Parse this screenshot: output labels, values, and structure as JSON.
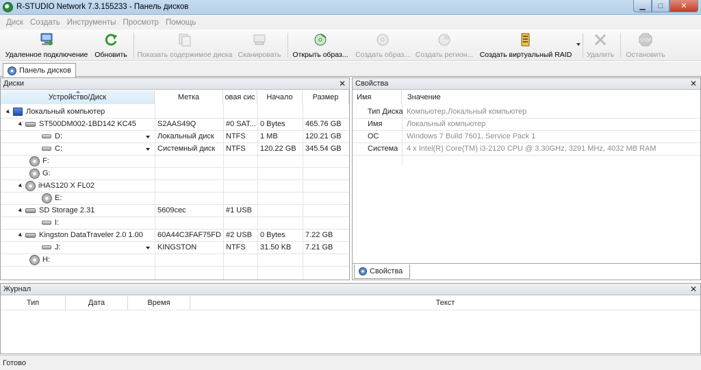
{
  "window": {
    "title": "R-STUDIO Network 7.3.155233 - Панель дисков",
    "min_glyph": "▁",
    "max_glyph": "□",
    "close_glyph": "✕"
  },
  "menu": [
    "Диск",
    "Создать",
    "Инструменты",
    "Просмотр",
    "Помощь"
  ],
  "toolbar": {
    "remote_connect": "Удаленное подключение",
    "refresh": "Обновить",
    "show_disk_contents": "Показать содержимое диска",
    "scan": "Сканировать",
    "open_image": "Открыть образ...",
    "create_image": "Создать образ...",
    "create_region": "Создать регион...",
    "create_virtual_raid": "Создать виртуальный RAID",
    "delete": "Удалить",
    "stop": "Остановить",
    "stop_badge": "STOP"
  },
  "doc_tab": {
    "label": "Панель дисков"
  },
  "disks_pane": {
    "title": "Диски",
    "close": "✕",
    "columns": [
      "Устройство/Диск",
      "Метка",
      "овая сис",
      "Начало",
      "Размер"
    ],
    "rows": [
      {
        "device": "Локальный компьютер",
        "label": "",
        "fs": "",
        "start": "",
        "size": ""
      },
      {
        "device": "ST500DM002-1BD142 KC45",
        "label": "S2AAS49Q",
        "fs": "#0 SAT...",
        "start": "0 Bytes",
        "size": "465.76 GB"
      },
      {
        "device": "D:",
        "label": "Локальный диск",
        "fs": "NTFS",
        "start": "1 MB",
        "size": "120.21 GB"
      },
      {
        "device": "C:",
        "label": "Системный диск",
        "fs": "NTFS",
        "start": "120.22 GB",
        "size": "345.54 GB"
      },
      {
        "device": "F:",
        "label": "",
        "fs": "",
        "start": "",
        "size": ""
      },
      {
        "device": "G:",
        "label": "",
        "fs": "",
        "start": "",
        "size": ""
      },
      {
        "device": "iHAS120 X FL02",
        "label": "",
        "fs": "",
        "start": "",
        "size": ""
      },
      {
        "device": "E:",
        "label": "",
        "fs": "",
        "start": "",
        "size": ""
      },
      {
        "device": "SD Storage 2.31",
        "label": "5609cec",
        "fs": "#1 USB",
        "start": "",
        "size": ""
      },
      {
        "device": "I:",
        "label": "",
        "fs": "",
        "start": "",
        "size": ""
      },
      {
        "device": "Kingston DataTraveler 2.0 1.00",
        "label": "60A44C3FAF75FD...",
        "fs": "#2 USB",
        "start": "0 Bytes",
        "size": "7.22 GB"
      },
      {
        "device": "J:",
        "label": "KINGSTON",
        "fs": "NTFS",
        "start": "31.50 KB",
        "size": "7.21 GB"
      },
      {
        "device": "H:",
        "label": "",
        "fs": "",
        "start": "",
        "size": ""
      }
    ]
  },
  "props_pane": {
    "title": "Свойства",
    "close": "✕",
    "columns": [
      "Имя",
      "Значение"
    ],
    "rows": [
      {
        "name": "Тип Диска",
        "value": "Компьютер,Локальный компьютер"
      },
      {
        "name": "Имя",
        "value": "Локальный компьютер"
      },
      {
        "name": "ОС",
        "value": "Windows 7 Build 7601, Service Pack 1"
      },
      {
        "name": "Система",
        "value": "4 x Intel(R) Core(TM) i3-2120 CPU @ 3.30GHz, 3291 MHz, 4032 MB RAM"
      }
    ],
    "bottom_tab": "Свойства"
  },
  "log_pane": {
    "title": "Журнал",
    "close": "✕",
    "columns": [
      "Тип",
      "Дата",
      "Время",
      "Текст"
    ]
  },
  "status": {
    "text": "Готово"
  }
}
